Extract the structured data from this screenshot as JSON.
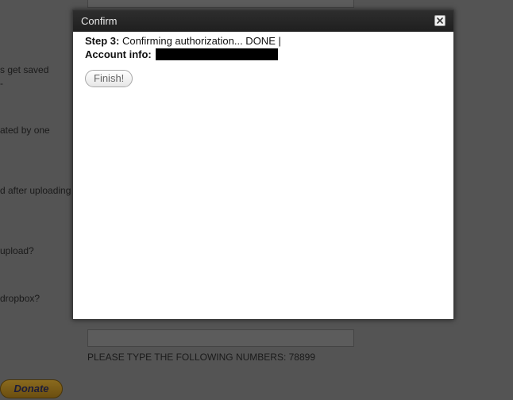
{
  "background": {
    "lines": [
      "s get saved",
      "-",
      "ated by one",
      "d after uploading",
      "upload?",
      " dropbox?"
    ],
    "captcha_prompt": "PLEASE TYPE THE FOLLOWING NUMBERS: 78899",
    "donate_label": "Donate"
  },
  "dialog": {
    "title": "Confirm",
    "step_label": "Step 3:",
    "step_text": " Confirming authorization... DONE |",
    "account_label": "Account info:",
    "finish_label": "Finish!"
  },
  "colors": {
    "overlay": "#545454",
    "titlebar": "#262626",
    "redaction": "#000000"
  }
}
